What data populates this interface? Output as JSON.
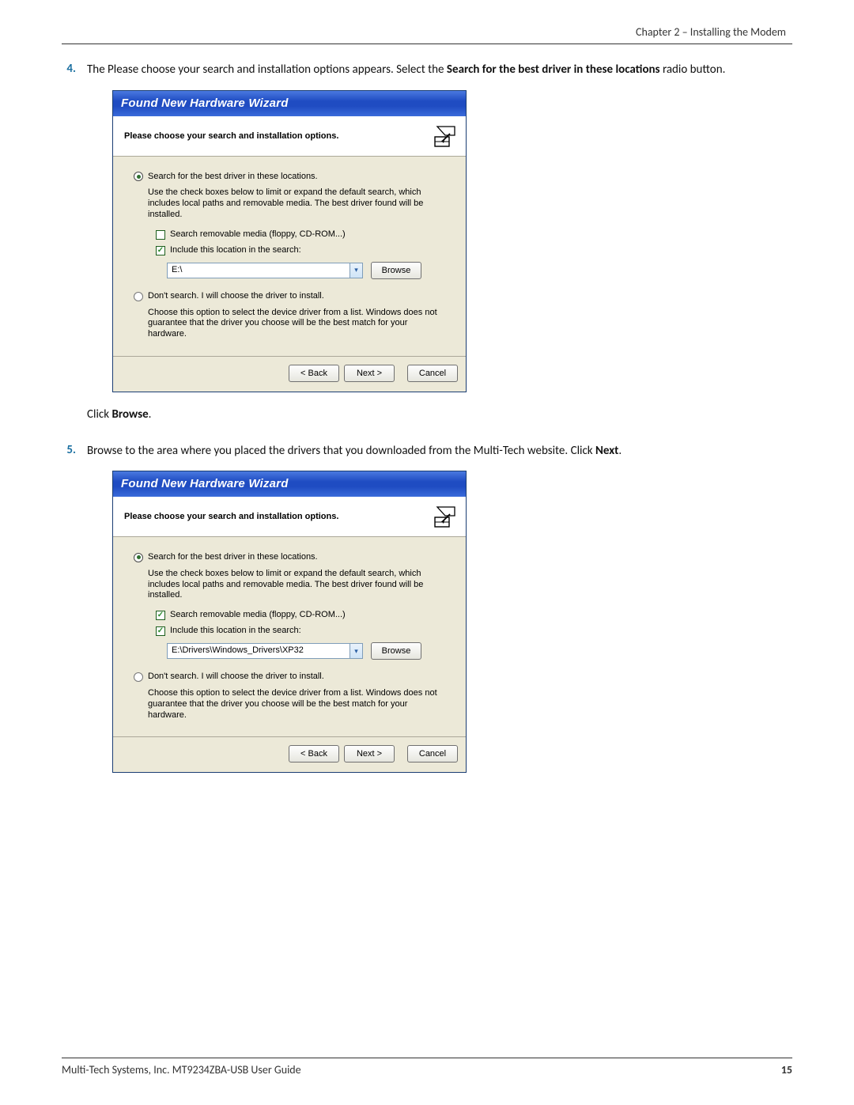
{
  "header": {
    "chapter": "Chapter 2 – Installing the Modem"
  },
  "steps": {
    "s4": {
      "num": "4.",
      "text_a": "The Please choose your search and installation options appears. Select the ",
      "bold_a": "Search for the best driver in these locations",
      "text_b": " radio button."
    },
    "mid": {
      "click": "Click ",
      "browse": "Browse",
      "period": "."
    },
    "s5": {
      "num": "5.",
      "text_a": "Browse to the area where you placed the drivers that you downloaded from the Multi-Tech website. Click ",
      "bold_a": "Next",
      "text_b": "."
    }
  },
  "wizard": {
    "title": "Found New Hardware Wizard",
    "head": "Please choose your search and installation options.",
    "opt1": "Search for the best driver in these locations.",
    "opt1desc": "Use the check boxes below to limit or expand the default search, which includes local paths and removable media. The best driver found will be installed.",
    "chk_removable": "Search removable media (floppy, CD-ROM...)",
    "chk_include": "Include this location in the search:",
    "opt2": "Don't search. I will choose the driver to install.",
    "opt2desc": "Choose this option to select the device driver from a list.  Windows does not guarantee that the driver you choose will be the best match for your hardware.",
    "btn_back": "< Back",
    "btn_next": "Next >",
    "btn_cancel": "Cancel",
    "btn_browse": "Browse"
  },
  "wiz1": {
    "path": "E:\\"
  },
  "wiz2": {
    "path": "E:\\Drivers\\Windows_Drivers\\XP32"
  },
  "footer": {
    "left": "Multi-Tech Systems, Inc. MT9234ZBA-USB User Guide",
    "right": "15"
  }
}
